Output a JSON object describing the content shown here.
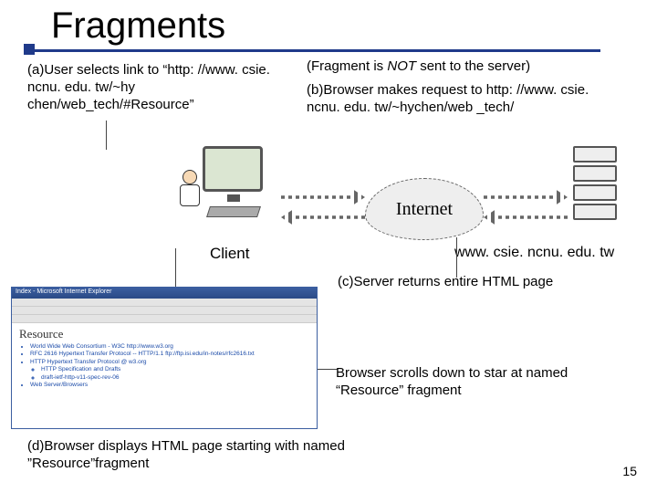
{
  "title": "Fragments",
  "step_a": "(a)User selects link to “http: //www. csie. ncnu. edu. tw/~hy chen/web_tech/#Resource”",
  "fragment_note_prefix": "(Fragment is ",
  "fragment_note_em": "NOT",
  "fragment_note_suffix": " sent to the server)",
  "step_b": "(b)Browser makes request to http: //www. csie. ncnu. edu. tw/~hychen/web _tech/",
  "client_label": "Client",
  "internet_label": "Internet",
  "server_label": "www. csie. ncnu. edu. tw",
  "step_c": "(c)Server returns entire HTML page",
  "scroll_note": "Browser scrolls down to star at named “Resource” fragment",
  "step_d": "(d)Browser displays HTML page starting with named ”Resource”fragment",
  "slide_number": "15",
  "browser_mock": {
    "titlebar": "Index - Microsoft Internet Explorer",
    "heading": "Resource",
    "links": [
      "World Wide Web Consortium - W3C  http://www.w3.org",
      "RFC 2616 Hypertext Transfer Protocol -- HTTP/1.1  ftp://ftp.isi.edu/in-notes/rfc2616.txt",
      "HTTP Hypertext Transfer Protocol @ w3.org",
      "HTTP Specification and Drafts",
      "draft-ietf-http-v11-spec-rev-06",
      "Web Server/Browsers"
    ]
  }
}
